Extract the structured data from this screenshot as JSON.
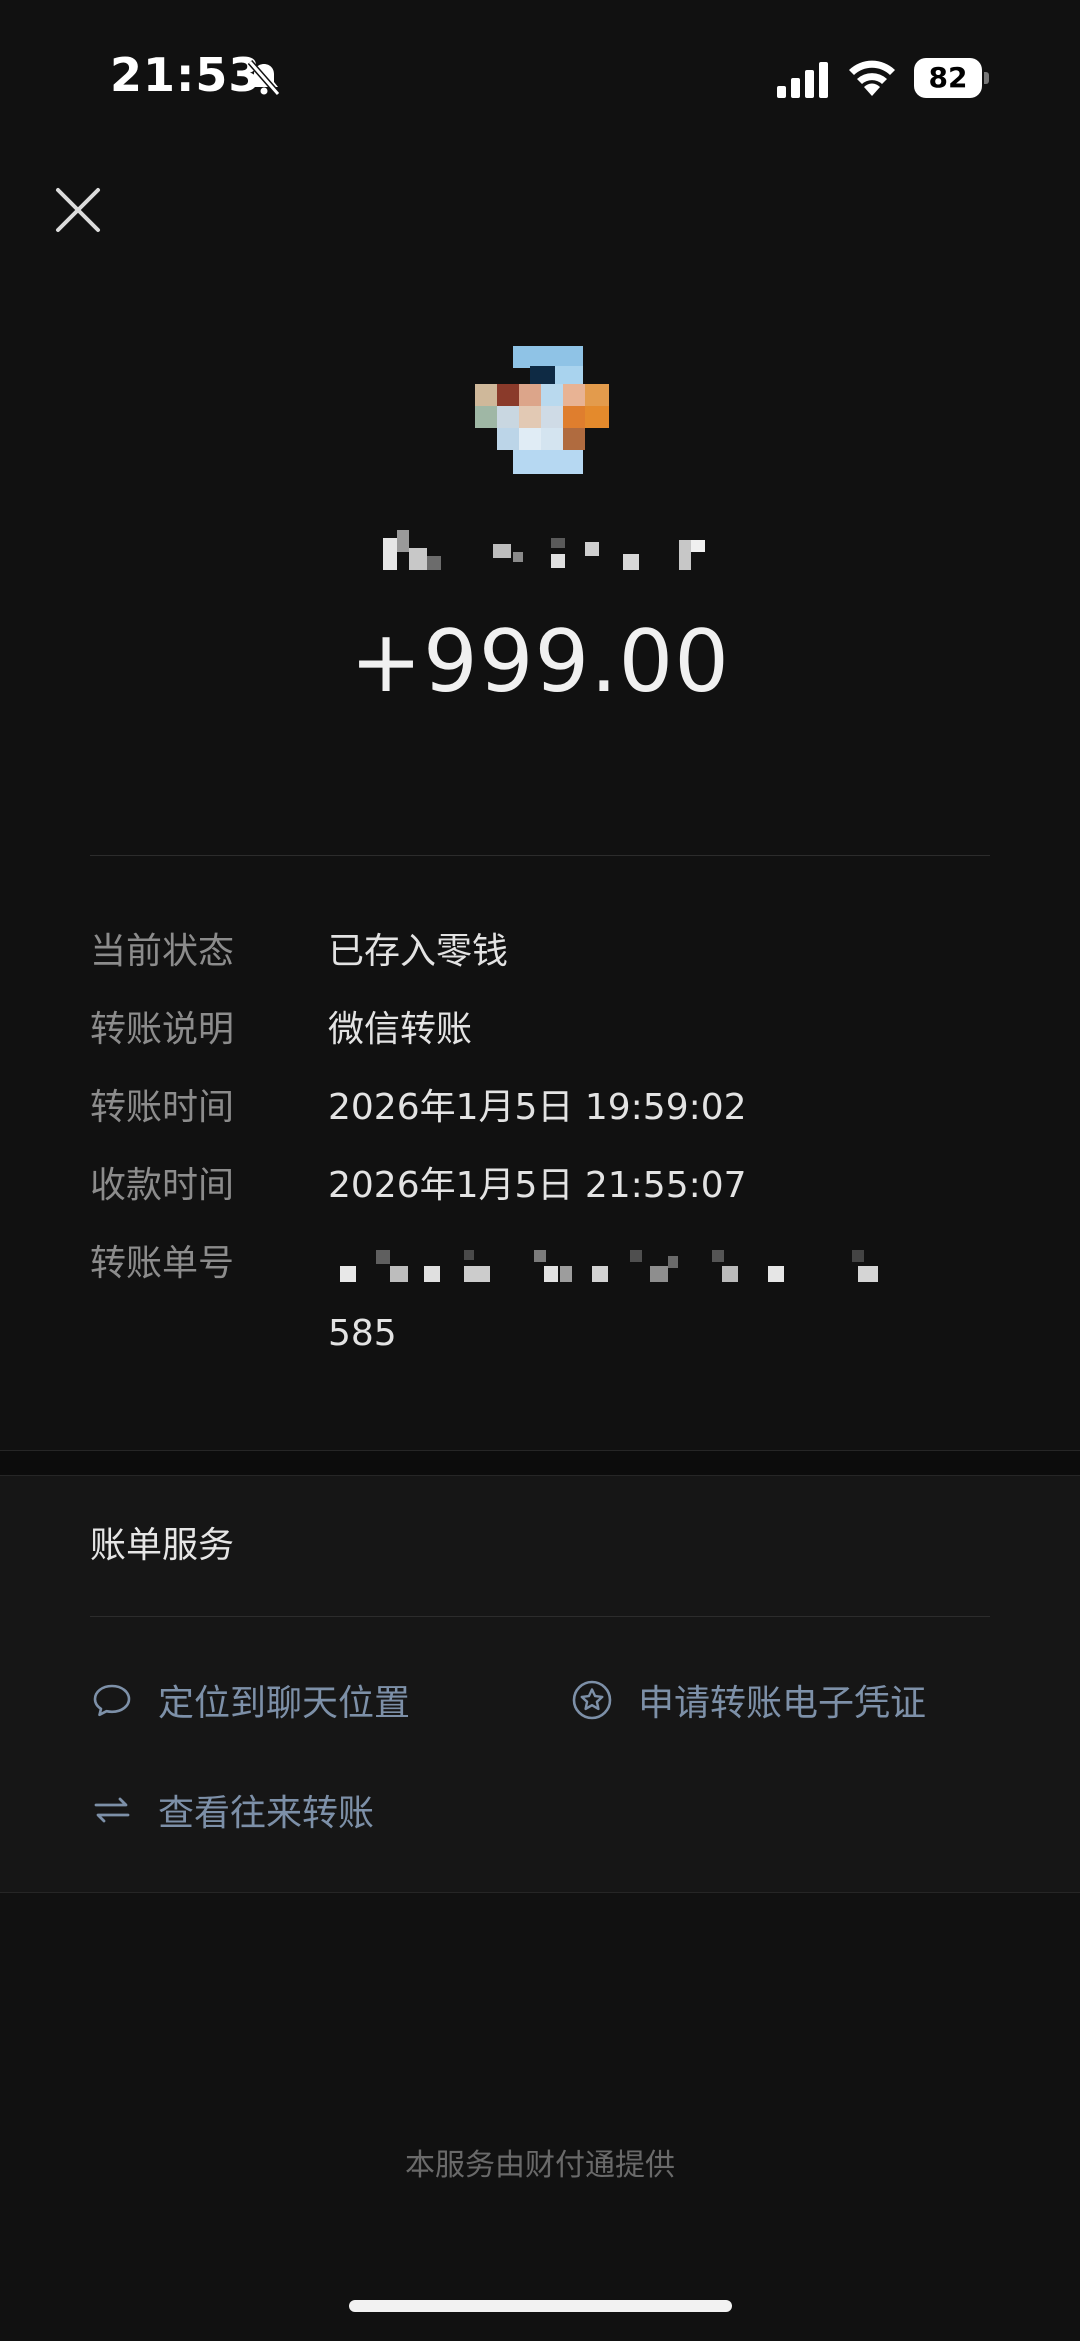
{
  "status_bar": {
    "time": "21:53",
    "battery": "82",
    "icons": [
      "bell-slash-icon",
      "signal-icon",
      "wifi-icon",
      "battery-icon"
    ]
  },
  "header": {
    "close_icon": "close-icon"
  },
  "payer": {
    "avatar_icon": "avatar-mosaic",
    "name_icon": "name-mosaic"
  },
  "amount": "+999.00",
  "details": {
    "status_label": "当前状态",
    "status_value": "已存入零钱",
    "note_label": "转账说明",
    "note_value": "微信转账",
    "transfer_time_label": "转账时间",
    "transfer_time_value": "2026年1月5日 19:59:02",
    "receive_time_label": "收款时间",
    "receive_time_value": "2026年1月5日 21:55:07",
    "order_label": "转账单号",
    "order_suffix": "585"
  },
  "services": {
    "title": "账单服务",
    "chat_link": "定位到聊天位置",
    "voucher_link": "申请转账电子凭证",
    "history_link": "查看往来转账",
    "icons": [
      "chat-bubble-icon",
      "star-badge-icon",
      "swap-arrows-icon"
    ]
  },
  "footer": "本服务由财付通提供",
  "colors": {
    "background": "#111111",
    "link": "#7d90a8",
    "label": "#8c8c8c"
  }
}
